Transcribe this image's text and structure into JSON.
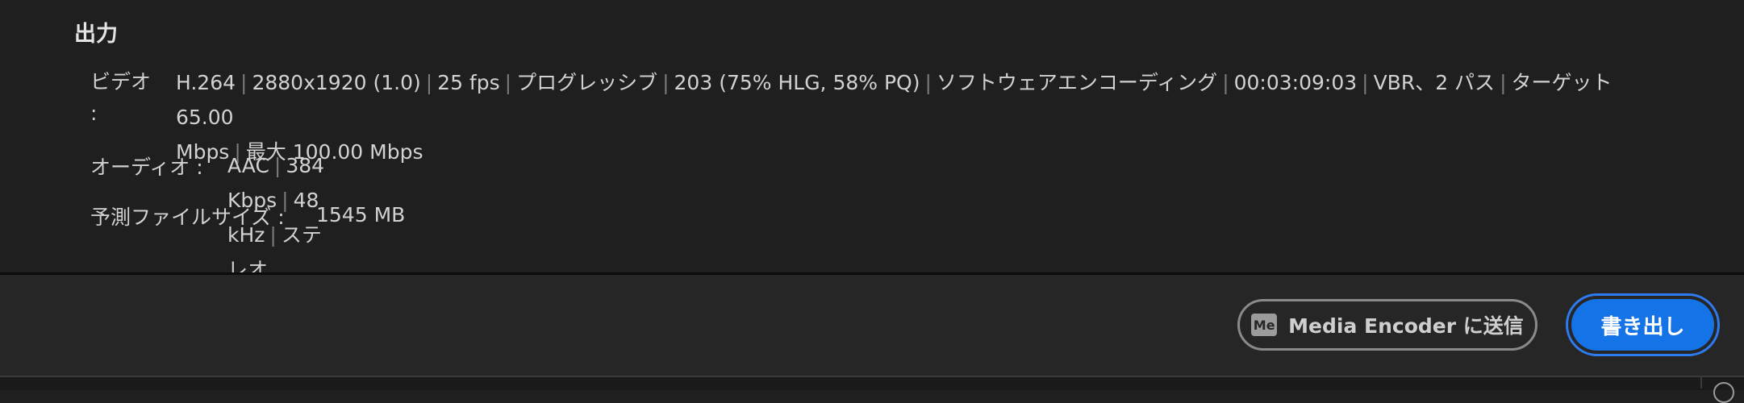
{
  "output": {
    "title": "出力",
    "video": {
      "label": "ビデオ",
      "colon": ":",
      "codec": "H.264",
      "resolution": "2880x1920 (1.0)",
      "fps": "25 fps",
      "scan": "プログレッシブ",
      "color": "203 (75% HLG, 58% PQ)",
      "encoding": "ソフトウェアエンコーディング",
      "duration": "00:03:09:03",
      "bitrate_mode": "VBR、2 パス",
      "target_a": "ターゲット 65.00",
      "target_b": "Mbps",
      "max": "最大 100.00 Mbps"
    },
    "audio": {
      "label": "オーディオ :",
      "codec": "AAC",
      "bitrate": "384 Kbps",
      "rate": "48 kHz",
      "channels": "ステレオ"
    },
    "filesize": {
      "label": "予測ファイルサイズ :",
      "value": "1545 MB"
    }
  },
  "footer": {
    "media_encoder_icon": "Me",
    "send_label": "Media Encoder に送信",
    "export_label": "書き出し"
  },
  "colors": {
    "background": "#1f1f1f",
    "footer": "#262626",
    "accent": "#1473e6"
  },
  "icons": {
    "media_encoder": "media-encoder-icon",
    "corner": "circle-icon"
  }
}
